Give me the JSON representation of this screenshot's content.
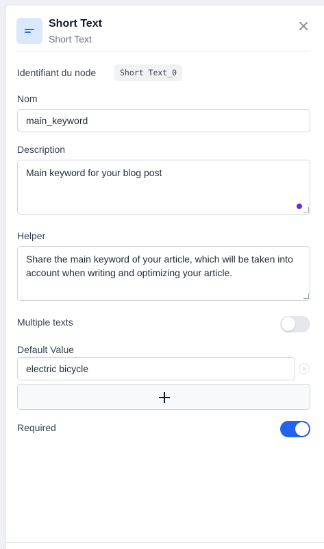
{
  "header": {
    "title": "Short Text",
    "subtitle": "Short Text",
    "icon": "short-text-icon"
  },
  "node_id": {
    "label": "Identifiant du node",
    "value": "Short Text_0"
  },
  "name": {
    "label": "Nom",
    "value": "main_keyword"
  },
  "description": {
    "label": "Description",
    "value": "Main keyword for your blog post"
  },
  "helper": {
    "label": "Helper",
    "value": "Share the main keyword of your article, which will be taken into account when writing and optimizing your article."
  },
  "multiple_texts": {
    "label": "Multiple texts",
    "enabled": false
  },
  "default_value": {
    "label": "Default Value",
    "value": "electric bicycle"
  },
  "required": {
    "label": "Required",
    "enabled": true
  },
  "colors": {
    "accent": "#2563eb",
    "icon_bg": "#dbe8fb",
    "status_dot": "#6d28d9"
  }
}
